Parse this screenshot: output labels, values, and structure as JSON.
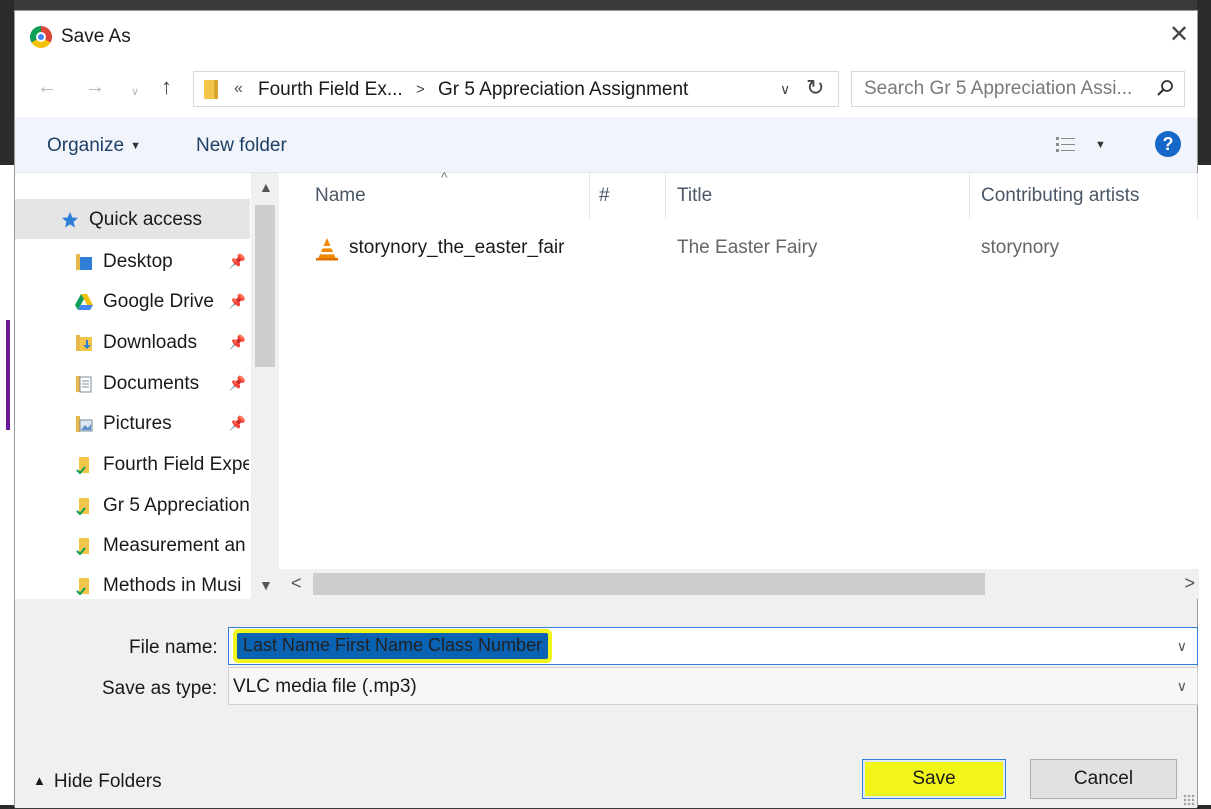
{
  "window": {
    "title": "Save As",
    "close_label": "✕"
  },
  "nav": {
    "back": "←",
    "forward": "→",
    "recent": "∨",
    "up": "↑",
    "address": {
      "chevron": "«",
      "segment1": "Fourth Field Ex...",
      "separator": ">",
      "segment2": "Gr 5 Appreciation Assignment",
      "dropdown": "∨",
      "refresh": "↻"
    },
    "search": {
      "placeholder": "Search Gr 5 Appreciation Assi..."
    }
  },
  "toolbar": {
    "organize": "Organize",
    "new_folder": "New folder",
    "help": "?"
  },
  "sidebar": {
    "items": [
      {
        "label": "Quick access",
        "icon": "star-icon"
      },
      {
        "label": "Desktop",
        "icon": "desktop-folder-icon",
        "pinned": true
      },
      {
        "label": "Google Drive",
        "icon": "google-drive-icon",
        "pinned": true
      },
      {
        "label": "Downloads",
        "icon": "downloads-folder-icon",
        "pinned": true
      },
      {
        "label": "Documents",
        "icon": "documents-folder-icon",
        "pinned": true
      },
      {
        "label": "Pictures",
        "icon": "pictures-folder-icon",
        "pinned": true
      },
      {
        "label": "Fourth Field Expe",
        "icon": "folder-icon"
      },
      {
        "label": "Gr 5 Appreciation",
        "icon": "folder-icon"
      },
      {
        "label": "Measurement an",
        "icon": "folder-icon"
      },
      {
        "label": "Methods in Musi",
        "icon": "folder-icon"
      }
    ]
  },
  "filelist": {
    "columns": [
      "Name",
      "#",
      "Title",
      "Contributing artists"
    ],
    "rows": [
      {
        "name": "storynory_the_easter_fair",
        "number": "",
        "title": "The Easter Fairy",
        "artist": "storynory",
        "icon": "vlc-icon"
      }
    ]
  },
  "form": {
    "file_name_label": "File name:",
    "file_name_value": "Last Name First Name Class Number",
    "save_type_label": "Save as type:",
    "save_type_value": "VLC media file (.mp3)"
  },
  "footer": {
    "hide_folders": "Hide Folders",
    "save": "Save",
    "cancel": "Cancel"
  },
  "colors": {
    "highlight": "#f2f51a",
    "selection": "#0a62b3",
    "accent": "#2f7fd6"
  }
}
